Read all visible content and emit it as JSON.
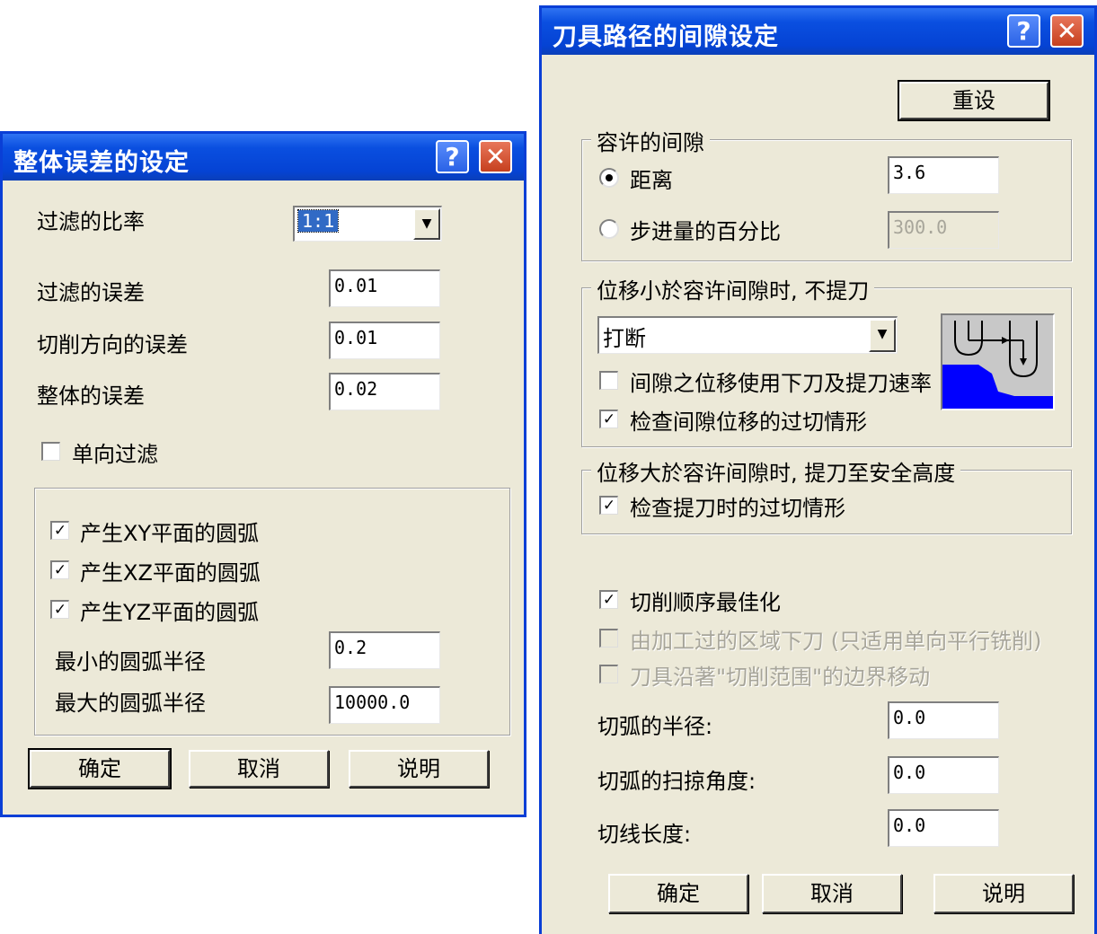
{
  "left_dialog": {
    "title": "整体误差的设定",
    "filter_ratio_label": "过滤的比率",
    "filter_ratio_value": "1:1",
    "filter_error_label": "过滤的误差",
    "filter_error_value": "0.01",
    "cut_dir_error_label": "切削方向的误差",
    "cut_dir_error_value": "0.01",
    "total_error_label": "整体的误差",
    "total_error_value": "0.02",
    "one_way_filter_label": "单向过滤",
    "arc_xy_label": "产生XY平面的圆弧",
    "arc_xz_label": "产生XZ平面的圆弧",
    "arc_yz_label": "产生YZ平面的圆弧",
    "min_radius_label": "最小的圆弧半径",
    "min_radius_value": "0.2",
    "max_radius_label": "最大的圆弧半径",
    "max_radius_value": "10000.0",
    "ok_label": "确定",
    "cancel_label": "取消",
    "help_label": "说明"
  },
  "right_dialog": {
    "title": "刀具路径的间隙设定",
    "reset_label": "重设",
    "gap_group_label": "容许的间隙",
    "distance_label": "距离",
    "distance_value": "3.6",
    "step_percent_label": "步进量的百分比",
    "step_percent_value": "300.0",
    "small_move_group_label": "位移小於容许间隙时, 不提刀",
    "small_move_option": "打断",
    "use_feed_rate_label": "间隙之位移使用下刀及提刀速率",
    "check_gouge_label": "检查间隙位移的过切情形",
    "large_move_group_label": "位移大於容许间隙时, 提刀至安全高度",
    "check_retract_gouge_label": "检查提刀时的过切情形",
    "optimize_order_label": "切削顺序最佳化",
    "plunge_machined_label": "由加工过的区域下刀 (只适用单向平行铣削)",
    "follow_boundary_label": "刀具沿著\"切削范围\"的边界移动",
    "arc_radius_label": "切弧的半径:",
    "arc_radius_value": "0.0",
    "arc_sweep_label": "切弧的扫掠角度:",
    "arc_sweep_value": "0.0",
    "tangent_length_label": "切线长度:",
    "tangent_length_value": "0.0",
    "ok_label": "确定",
    "cancel_label": "取消",
    "help_label": "说明"
  },
  "icons": {
    "help": "?",
    "close": "✕",
    "check": "✓",
    "dropdown": "▼"
  },
  "colors": {
    "titlebar": "#0543d4",
    "dialog_bg": "#ece9d8",
    "preview_fill": "#0000ff"
  }
}
